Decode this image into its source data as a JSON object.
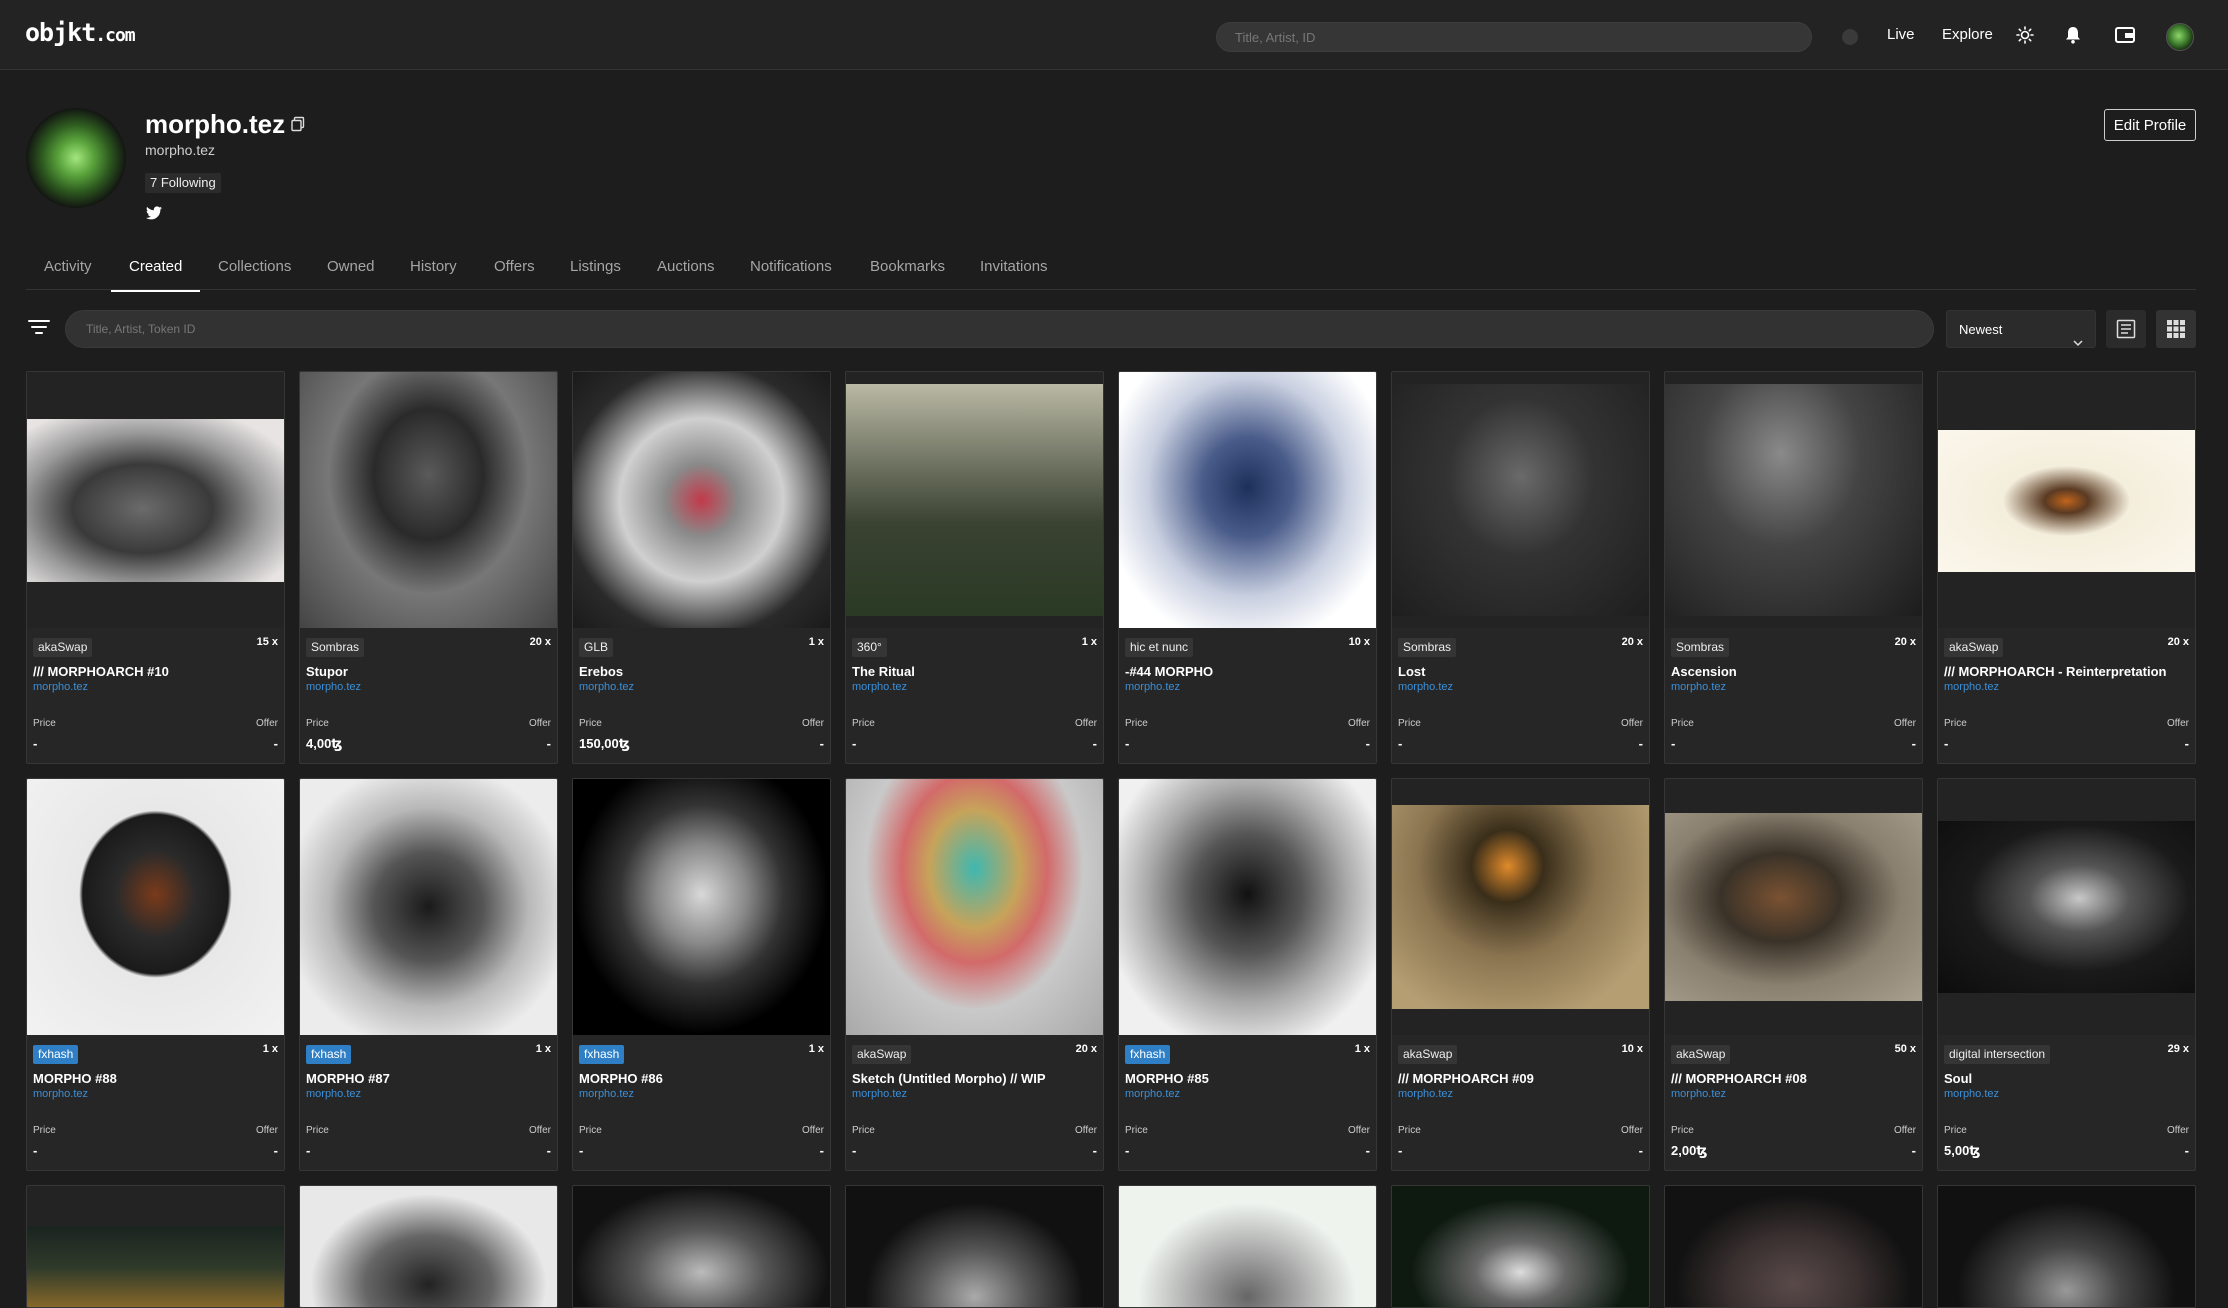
{
  "header": {
    "logo_main": "objkt",
    "logo_suffix": ".com",
    "search_placeholder": "Title, Artist, ID",
    "nav": {
      "live": "Live",
      "explore": "Explore"
    },
    "icons": [
      "sun-icon",
      "bell-icon",
      "wallet-icon"
    ]
  },
  "profile": {
    "name": "morpho.tez",
    "handle": "morpho.tez",
    "following": "7 Following",
    "edit_label": "Edit Profile"
  },
  "tabs": [
    "Activity",
    "Created",
    "Collections",
    "Owned",
    "History",
    "Offers",
    "Listings",
    "Auctions",
    "Notifications",
    "Bookmarks",
    "Invitations"
  ],
  "active_tab": "Created",
  "filters": {
    "search_placeholder": "Title, Artist, Token ID",
    "sort": "Newest"
  },
  "labels": {
    "price": "Price",
    "offer": "Offer"
  },
  "tokens": [
    {
      "platform": "akaSwap",
      "editions": "15 x",
      "title": "/// MORPHOARCH #10",
      "artist": "morpho.tez",
      "price": "-",
      "offer": "-"
    },
    {
      "platform": "Sombras",
      "editions": "20 x",
      "title": "Stupor",
      "artist": "morpho.tez",
      "price": "4,00ꜩ",
      "offer": "-"
    },
    {
      "platform": "GLB",
      "editions": "1 x",
      "title": "Erebos",
      "artist": "morpho.tez",
      "price": "150,00ꜩ",
      "offer": "-"
    },
    {
      "platform": "360°",
      "editions": "1 x",
      "title": "The Ritual",
      "artist": "morpho.tez",
      "price": "-",
      "offer": "-"
    },
    {
      "platform": "hic et nunc",
      "editions": "10 x",
      "title": "-#44 MORPHO",
      "artist": "morpho.tez",
      "price": "-",
      "offer": "-"
    },
    {
      "platform": "Sombras",
      "editions": "20 x",
      "title": "Lost",
      "artist": "morpho.tez",
      "price": "-",
      "offer": "-"
    },
    {
      "platform": "Sombras",
      "editions": "20 x",
      "title": "Ascension",
      "artist": "morpho.tez",
      "price": "-",
      "offer": "-"
    },
    {
      "platform": "akaSwap",
      "editions": "20 x",
      "title": "/// MORPHOARCH - Reinterpretation",
      "artist": "morpho.tez",
      "price": "-",
      "offer": "-"
    },
    {
      "platform": "fxhash",
      "editions": "1 x",
      "title": "MORPHO #88",
      "artist": "morpho.tez",
      "price": "-",
      "offer": "-"
    },
    {
      "platform": "fxhash",
      "editions": "1 x",
      "title": "MORPHO #87",
      "artist": "morpho.tez",
      "price": "-",
      "offer": "-"
    },
    {
      "platform": "fxhash",
      "editions": "1 x",
      "title": "MORPHO #86",
      "artist": "morpho.tez",
      "price": "-",
      "offer": "-"
    },
    {
      "platform": "akaSwap",
      "editions": "20 x",
      "title": "Sketch (Untitled Morpho) // WIP",
      "artist": "morpho.tez",
      "price": "-",
      "offer": "-"
    },
    {
      "platform": "fxhash",
      "editions": "1 x",
      "title": "MORPHO #85",
      "artist": "morpho.tez",
      "price": "-",
      "offer": "-"
    },
    {
      "platform": "akaSwap",
      "editions": "10 x",
      "title": "/// MORPHOARCH #09",
      "artist": "morpho.tez",
      "price": "-",
      "offer": "-"
    },
    {
      "platform": "akaSwap",
      "editions": "50 x",
      "title": "/// MORPHOARCH #08",
      "artist": "morpho.tez",
      "price": "2,00ꜩ",
      "offer": "-"
    },
    {
      "platform": "digital intersection",
      "editions": "29 x",
      "title": "Soul",
      "artist": "morpho.tez",
      "price": "5,00ꜩ",
      "offer": "-"
    }
  ],
  "colors": {
    "accent_link": "#3b8fd8",
    "fxhash_badge": "#2f7fc6",
    "background": "#1d1d1d"
  }
}
